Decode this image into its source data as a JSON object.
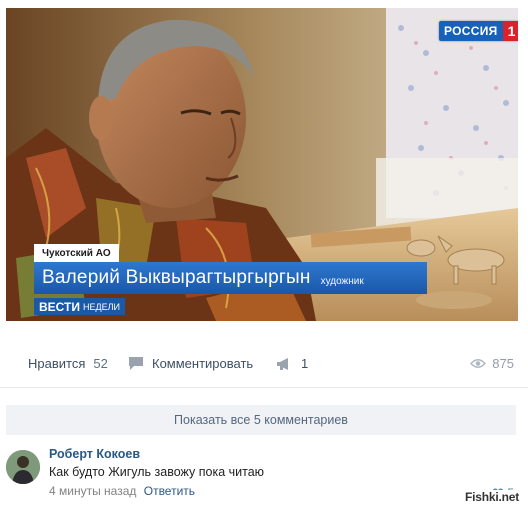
{
  "video": {
    "channel_name": "РОССИЯ",
    "channel_number": "1",
    "region": "Чукотский АО",
    "person_name": "Валерий Выквырагтыргыргын",
    "person_role": "художник",
    "program_strong": "ВЕСТИ",
    "program_rest": "НЕДЕЛИ"
  },
  "actions": {
    "like_label": "Нравится",
    "like_count": "52",
    "comment_label": "Комментировать",
    "share_count": "1",
    "views_count": "875"
  },
  "show_all_comments": "Показать все 5 комментариев",
  "comment": {
    "author": "Роберт Кокоев",
    "text": "Как будто Жигуль завожу пока читаю",
    "time": "4 минуты назад",
    "reply_label": "Ответить",
    "like_count": "5"
  },
  "watermark": "Fishki.net",
  "colors": {
    "link": "#2a5885",
    "name_plate": "#1a58a8",
    "channel_red": "#d8232a"
  },
  "icons": [
    "comment-icon",
    "megaphone-icon",
    "eye-icon",
    "heart-icon"
  ]
}
